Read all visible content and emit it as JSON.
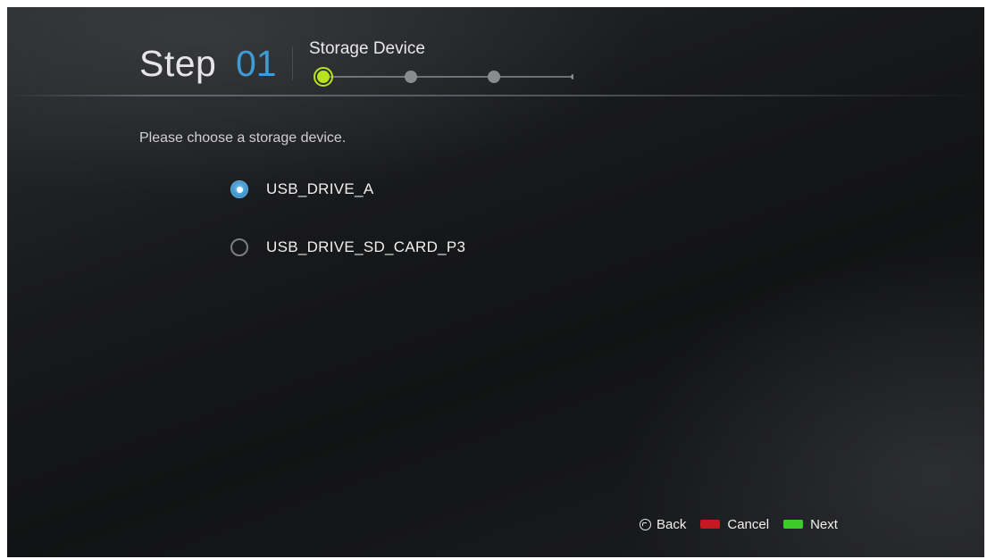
{
  "header": {
    "step_word": "Step",
    "step_number": "01",
    "step_title": "Storage Device"
  },
  "progress": {
    "total_steps": 3,
    "current_step": 1,
    "active_color": "#b7e31f",
    "inactive_color": "#8a8b8d"
  },
  "main": {
    "prompt": "Please choose a storage device.",
    "options": [
      {
        "label": "USB_DRIVE_A",
        "selected": true
      },
      {
        "label": "USB_DRIVE_SD_CARD_P3",
        "selected": false
      }
    ],
    "accent_color": "#3f9bd6"
  },
  "footer": {
    "back_label": "Back",
    "back_icon": "back-icon",
    "cancel_label": "Cancel",
    "cancel_color": "#c41822",
    "next_label": "Next",
    "next_color": "#3ccc2a"
  }
}
